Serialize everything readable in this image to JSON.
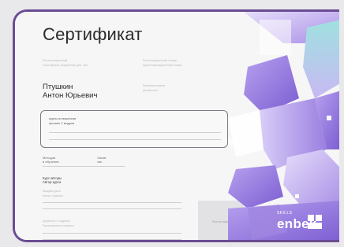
{
  "certificate": {
    "title": "Сертификат",
    "name_line1": "Птушкин",
    "name_line2": "Антон Юрьевич",
    "faint": {
      "top_left_1": "Регистрационный",
      "top_left_2": "Сертификат, выданный для: сво",
      "top_right_1": "Регистрационный номер",
      "top_right_2": "Идентификационный номер",
      "mid_right_1": "Фамилия имени",
      "mid_right_2": "Должность",
      "date_label_1": "Выдачи дата",
      "date_label_2": "Автор подписи",
      "sig_label_1": "Директор и подпись",
      "sig_label_2": "Руководитель подпись"
    },
    "box": {
      "line1": "курсы из вакансии",
      "line2": "прошел 2 модуля"
    },
    "stats": {
      "left_1": "Методов",
      "left_2": "в обучении",
      "right_1": "Часов",
      "right_2": "час"
    },
    "author": {
      "line1": "Курс авторы",
      "line2": "Автор курса"
    },
    "photo_label": "Фотография"
  },
  "brand": {
    "skills": "SKILLS",
    "name": "enbek",
    "accent": "#6a4c93",
    "purple": "#8b6fd6",
    "lavender": "#c8b9f2",
    "teal": "#8fd6d8"
  }
}
